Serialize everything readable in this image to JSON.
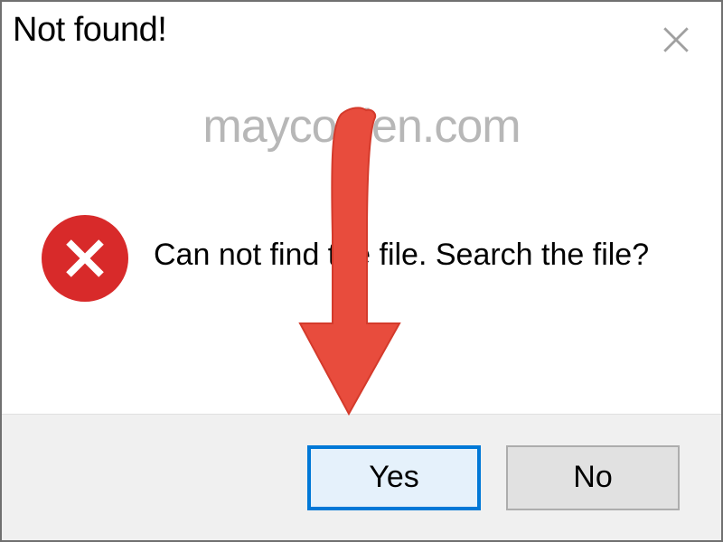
{
  "dialog": {
    "title": "Not found!",
    "message": "Can not find the file. Search the file?",
    "yes_label": "Yes",
    "no_label": "No"
  },
  "watermark": "maycodien.com",
  "colors": {
    "primary_border": "#0078d7",
    "error_bg": "#d82a2a",
    "arrow": "#e84c3d"
  }
}
